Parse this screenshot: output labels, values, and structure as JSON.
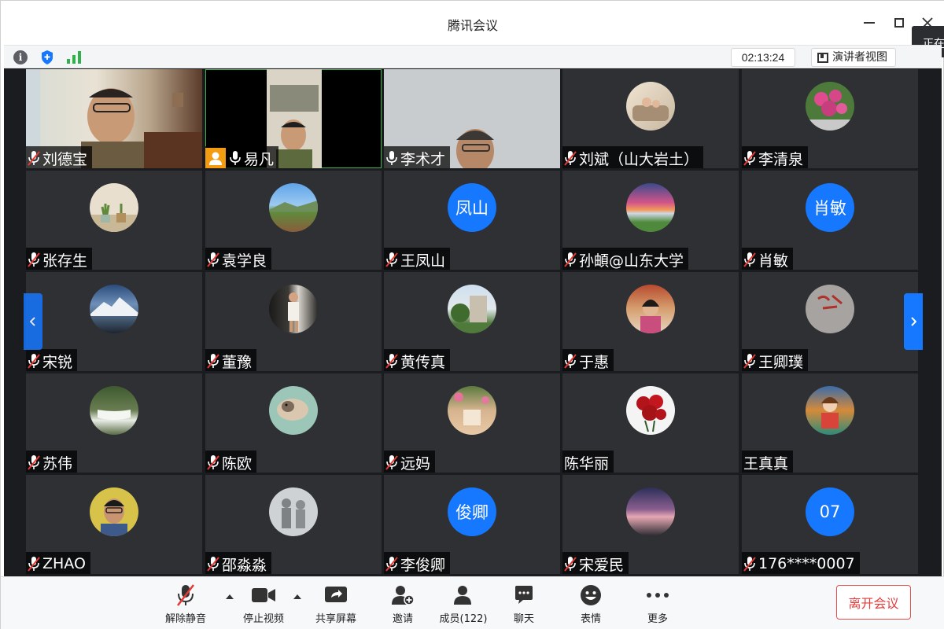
{
  "window": {
    "title": "腾讯会议",
    "side_tag": "正在"
  },
  "infobar": {
    "timer": "02:13:24",
    "speaker_view_label": "演讲者视图"
  },
  "participants": [
    {
      "name": "刘德宝",
      "muted": true
    },
    {
      "name": "易凡",
      "muted": false,
      "host": true
    },
    {
      "name": "李术才",
      "muted": false
    },
    {
      "name": "刘斌（山大岩土）",
      "muted": true
    },
    {
      "name": "李清泉",
      "muted": true
    },
    {
      "name": "张存生",
      "muted": true
    },
    {
      "name": "袁学良",
      "muted": true
    },
    {
      "name": "王凤山",
      "muted": true,
      "avatar_text": "凤山"
    },
    {
      "name": "孙頔@山东大学",
      "muted": true
    },
    {
      "name": "肖敏",
      "muted": true,
      "avatar_text": "肖敏"
    },
    {
      "name": "宋锐",
      "muted": true
    },
    {
      "name": "董豫",
      "muted": true
    },
    {
      "name": "黄传真",
      "muted": true
    },
    {
      "name": "于惠",
      "muted": true
    },
    {
      "name": "王卿璞",
      "muted": true
    },
    {
      "name": "苏伟",
      "muted": true
    },
    {
      "name": "陈欧",
      "muted": true
    },
    {
      "name": "远妈",
      "muted": true
    },
    {
      "name": "陈华丽",
      "muted": false,
      "no_mic": true
    },
    {
      "name": "王真真",
      "muted": false,
      "no_mic": true
    },
    {
      "name": "ZHAO",
      "muted": true
    },
    {
      "name": "邵淼淼",
      "muted": true
    },
    {
      "name": "李俊卿",
      "muted": true,
      "avatar_text": "俊卿"
    },
    {
      "name": "宋爱民",
      "muted": true
    },
    {
      "name": "176****0007",
      "muted": true,
      "avatar_text": "07"
    }
  ],
  "toolbar": {
    "unmute": "解除静音",
    "stop_video": "停止视频",
    "share_screen": "共享屏幕",
    "invite": "邀请",
    "members": "成员(122)",
    "chat": "聊天",
    "reactions": "表情",
    "more": "更多",
    "leave": "离开会议"
  },
  "colors": {
    "accent": "#1677ff",
    "leave": "#e03c3c",
    "host": "#f39c12"
  }
}
